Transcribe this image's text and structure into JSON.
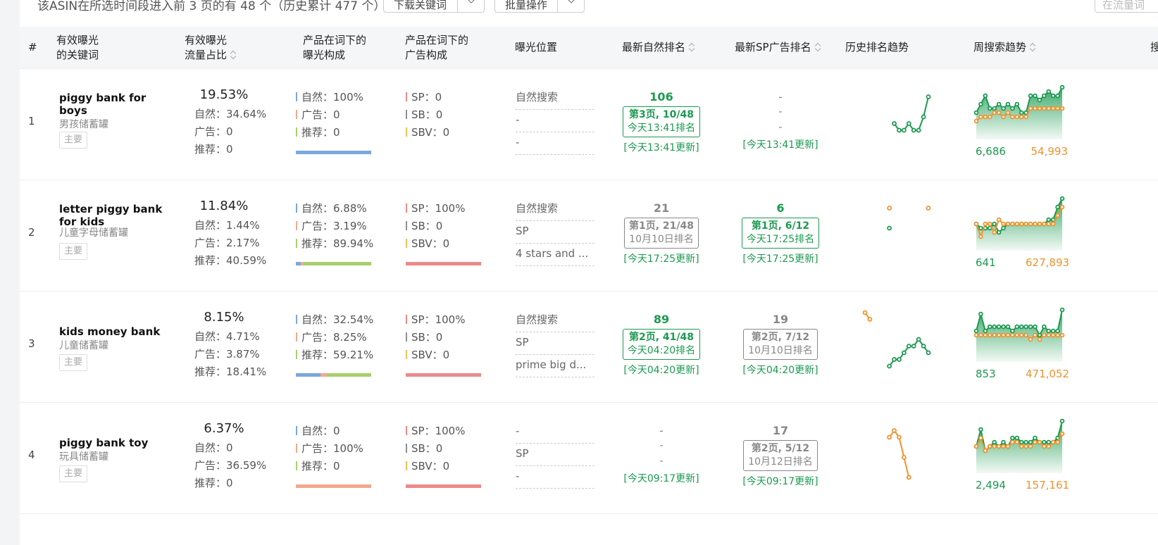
{
  "toolbar": {
    "summary": "该ASIN在所选时间段进入前 3 页的有 48 个（历史累计 477 个）",
    "download_label": "下载关键词",
    "batch_label": "批量操作",
    "search_placeholder": "在流量词"
  },
  "headers": {
    "index": "#",
    "keyword_l1": "有效曝光",
    "keyword_l2": "的关键词",
    "share_l1": "有效曝光",
    "share_l2": "流量占比",
    "exposure_l1": "产品在词下的",
    "exposure_l2": "曝光构成",
    "ad_l1": "产品在词下的",
    "ad_l2": "广告构成",
    "position": "曝光位置",
    "natural_rank": "最新自然排名",
    "sp_rank": "最新SP广告排名",
    "history": "历史排名趋势",
    "weekly": "周搜索趋势",
    "extra": "搜"
  },
  "colors": {
    "green": "#1a9a4f",
    "orange": "#f0922b",
    "natural_bar": "#7aa7e0",
    "ad_bar": "#f2a98e",
    "rec_bar": "#a9cf6b",
    "sp_bar": "#ec8a8a",
    "sb_bar": "#8f8f8f",
    "sbv_bar": "#f0c15a"
  },
  "rows": [
    {
      "index": "1",
      "keyword": "piggy bank for boys",
      "keyword_cn": "男孩储蓄罐",
      "tag": "主要",
      "share": "19.53%",
      "share_natural": "自然：34.64%",
      "share_ad": "广告：0",
      "share_rec": "推荐：0",
      "exp_natural": "自然：100%",
      "exp_ad": "广告：0",
      "exp_rec": "推荐：0",
      "exp_pct": [
        100,
        0,
        0
      ],
      "ad_sp": "SP：0",
      "ad_sb": "SB：0",
      "ad_sbv": "SBV：0",
      "ad_pct": [
        0,
        0,
        0
      ],
      "positions": [
        "自然搜索",
        "-",
        "-"
      ],
      "natural": {
        "rank": "106",
        "page": "第3页, 10/48",
        "time": "今天13:41排名",
        "updated": "[今天13:41更新]",
        "active": true
      },
      "sp": {
        "rank": "-",
        "page": "-",
        "time": "-",
        "updated": "[今天13:41更新]",
        "active": false,
        "empty": true
      },
      "history": {
        "green": [
          null,
          null,
          null,
          null,
          null,
          null,
          5,
          6,
          6,
          5,
          6,
          6,
          4,
          1
        ],
        "orange": []
      },
      "weekly": {
        "green": [
          6,
          4,
          2,
          5,
          5,
          4,
          5,
          4,
          5,
          4,
          6,
          6,
          2,
          2,
          3,
          2,
          1,
          2,
          2,
          0
        ],
        "orange": [
          8,
          7,
          7,
          7,
          6,
          6,
          7,
          6,
          7,
          7,
          7,
          7,
          5,
          5,
          5,
          5,
          5,
          5,
          5,
          5
        ],
        "low": "6,686",
        "high": "54,993"
      }
    },
    {
      "index": "2",
      "keyword": "letter piggy bank for kids",
      "keyword_cn": "儿童字母储蓄罐",
      "tag": "主要",
      "share": "11.84%",
      "share_natural": "自然：1.44%",
      "share_ad": "广告：2.17%",
      "share_rec": "推荐：40.59%",
      "exp_natural": "自然：6.88%",
      "exp_ad": "广告：3.19%",
      "exp_rec": "推荐：89.94%",
      "exp_pct": [
        6.88,
        3.19,
        89.94
      ],
      "ad_sp": "SP：100%",
      "ad_sb": "SB：0",
      "ad_sbv": "SBV：0",
      "ad_pct": [
        100,
        0,
        0
      ],
      "positions": [
        "自然搜索",
        "SP",
        "4 stars and ..."
      ],
      "natural": {
        "rank": "21",
        "page": "第1页, 21/48",
        "time": "10月10日排名",
        "updated": "[今天17:25更新]",
        "active": false
      },
      "sp": {
        "rank": "6",
        "page": "第1页, 6/12",
        "time": "今天17:25排名",
        "updated": "[今天17:25更新]",
        "active": true
      },
      "history": {
        "green": [
          null,
          null,
          null,
          null,
          null,
          4,
          null,
          null,
          null,
          null,
          null,
          null,
          null,
          null
        ],
        "orange": [
          null,
          null,
          null,
          null,
          null,
          1,
          null,
          null,
          null,
          null,
          null,
          null,
          null,
          1
        ]
      },
      "weekly": {
        "green": [
          6,
          7,
          7,
          7,
          6,
          8,
          7,
          6,
          6,
          6,
          6,
          6,
          6,
          6,
          6,
          6,
          5,
          5,
          2,
          0
        ],
        "orange": [
          6,
          9,
          6,
          6,
          8,
          5,
          6,
          6,
          6,
          6,
          6,
          6,
          6,
          6,
          6,
          6,
          6,
          6,
          4,
          2
        ],
        "low": "641",
        "high": "627,893"
      }
    },
    {
      "index": "3",
      "keyword": "kids money bank",
      "keyword_cn": "儿童储蓄罐",
      "tag": "主要",
      "share": "8.15%",
      "share_natural": "自然：4.71%",
      "share_ad": "广告：3.87%",
      "share_rec": "推荐：18.41%",
      "exp_natural": "自然：32.54%",
      "exp_ad": "广告：8.25%",
      "exp_rec": "推荐：59.21%",
      "exp_pct": [
        32.54,
        8.25,
        59.21
      ],
      "ad_sp": "SP：100%",
      "ad_sb": "SB：0",
      "ad_sbv": "SBV：0",
      "ad_pct": [
        100,
        0,
        0
      ],
      "positions": [
        "自然搜索",
        "SP",
        "prime big d..."
      ],
      "natural": {
        "rank": "89",
        "page": "第2页, 41/48",
        "time": "今天04:20排名",
        "updated": "[今天04:20更新]",
        "active": true
      },
      "sp": {
        "rank": "19",
        "page": "第2页, 7/12",
        "time": "10月10日排名",
        "updated": "[今天04:20更新]",
        "active": false
      },
      "history": {
        "green": [
          null,
          null,
          null,
          null,
          null,
          8,
          7,
          7,
          6,
          5,
          5,
          4,
          5,
          6
        ],
        "orange": [
          0,
          1,
          null,
          null,
          null,
          null,
          null,
          null,
          null,
          null,
          null,
          null,
          null,
          null
        ]
      },
      "weekly": {
        "green": [
          5,
          1,
          5,
          4,
          4,
          4,
          4,
          4,
          5,
          4,
          4,
          4,
          4,
          4,
          6,
          4,
          5,
          5,
          5,
          0
        ],
        "orange": [
          6,
          6,
          6,
          6,
          6,
          6,
          6,
          6,
          6,
          6,
          6,
          6,
          7,
          6,
          7,
          6,
          6,
          6,
          6,
          6
        ],
        "low": "853",
        "high": "471,052"
      }
    },
    {
      "index": "4",
      "keyword": "piggy bank toy",
      "keyword_cn": "玩具储蓄罐",
      "tag": "主要",
      "share": "6.37%",
      "share_natural": "自然：0",
      "share_ad": "广告：36.59%",
      "share_rec": "推荐：0",
      "exp_natural": "自然：0",
      "exp_ad": "广告：100%",
      "exp_rec": "推荐：0",
      "exp_pct": [
        0,
        100,
        0
      ],
      "ad_sp": "SP：100%",
      "ad_sb": "SB：0",
      "ad_sbv": "SBV：0",
      "ad_pct": [
        100,
        0,
        0
      ],
      "positions": [
        "-",
        "SP",
        "-"
      ],
      "natural": {
        "rank": "-",
        "page": "-",
        "time": "-",
        "updated": "[今天09:17更新]",
        "active": false,
        "empty": true
      },
      "sp": {
        "rank": "17",
        "page": "第2页, 5/12",
        "time": "10月12日排名",
        "updated": "[今天09:17更新]",
        "active": false
      },
      "history": {
        "green": [],
        "orange": [
          null,
          null,
          null,
          null,
          null,
          2,
          1,
          2,
          5,
          8,
          null,
          null,
          null,
          null
        ]
      },
      "weekly": {
        "green": [
          6,
          2,
          7,
          6,
          5,
          6,
          5,
          6,
          4,
          4,
          5,
          5,
          5,
          4,
          5,
          5,
          5,
          5,
          4,
          0
        ],
        "orange": [
          6,
          4,
          7,
          6,
          6,
          6,
          6,
          6,
          5,
          5,
          6,
          6,
          6,
          5,
          5,
          6,
          6,
          5,
          5,
          3
        ],
        "low": "2,494",
        "high": "157,161"
      }
    }
  ]
}
